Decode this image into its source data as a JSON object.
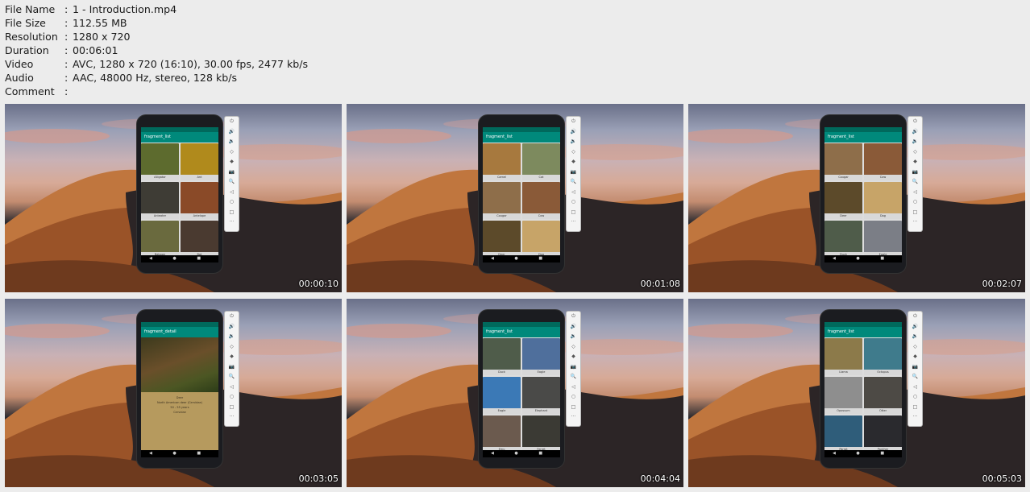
{
  "meta": [
    {
      "key": "File Name",
      "value": "1 - Introduction.mp4"
    },
    {
      "key": "File Size",
      "value": "112.55 MB"
    },
    {
      "key": "Resolution",
      "value": "1280 x 720"
    },
    {
      "key": "Duration",
      "value": "00:06:01"
    },
    {
      "key": "Video",
      "value": "AVC, 1280 x 720 (16:10), 30.00 fps, 2477 kb/s"
    },
    {
      "key": "Audio",
      "value": "AAC, 48000 Hz, stereo, 128 kb/s"
    },
    {
      "key": "Comment",
      "value": ""
    }
  ],
  "separator": ":",
  "emulator_icons": [
    "⏻",
    "🔊",
    "🔉",
    "◇",
    "◆",
    "📷",
    "🔍",
    "◁",
    "○",
    "□",
    "···"
  ],
  "navbar": "◀ ● ■",
  "thumbs": [
    {
      "time": "00:00:10",
      "appbar": "fragment_list",
      "tiles": [
        {
          "label": "Alligator",
          "color": "#5d6b2e"
        },
        {
          "label": "Ant",
          "color": "#b08a1c"
        },
        {
          "label": "Anteater",
          "color": "#3e3c35"
        },
        {
          "label": "Antelope",
          "color": "#8a4a28"
        },
        {
          "label": "Baboon",
          "color": "#6a6a3e"
        },
        {
          "label": "Bat",
          "color": "#4a3a30"
        }
      ]
    },
    {
      "time": "00:01:08",
      "appbar": "fragment_list",
      "tiles": [
        {
          "label": "Camel",
          "color": "#a7793e"
        },
        {
          "label": "Cat",
          "color": "#7d8a5e"
        },
        {
          "label": "Cougar",
          "color": "#8e6e4a"
        },
        {
          "label": "Cow",
          "color": "#8a5a38"
        },
        {
          "label": "Deer",
          "color": "#5c4a2a"
        },
        {
          "label": "Dog",
          "color": "#c7a468"
        }
      ]
    },
    {
      "time": "00:02:07",
      "appbar": "fragment_list",
      "tiles": [
        {
          "label": "Cougar",
          "color": "#8e6e4a"
        },
        {
          "label": "Cow",
          "color": "#8a5a38"
        },
        {
          "label": "Deer",
          "color": "#5c4a2a"
        },
        {
          "label": "Dog",
          "color": "#c7a468"
        },
        {
          "label": "Duck",
          "color": "#4f5c4a"
        },
        {
          "label": "Eagle",
          "color": "#7b7e86"
        }
      ]
    },
    {
      "time": "00:03:05",
      "appbar": "fragment_detail",
      "detail": true,
      "detail_title": "Deer",
      "detail_lines": [
        "North American deer (Cervidae)",
        "50 - 55 years",
        "Cervidae"
      ]
    },
    {
      "time": "00:04:04",
      "appbar": "fragment_list",
      "tiles": [
        {
          "label": "Duck",
          "color": "#4f5c4a"
        },
        {
          "label": "Eagle",
          "color": "#4f6f9c"
        },
        {
          "label": "Eagle",
          "color": "#3b79b6"
        },
        {
          "label": "Elephant",
          "color": "#4a4a48"
        },
        {
          "label": "Emu",
          "color": "#6b5a4e"
        },
        {
          "label": "Ferret",
          "color": "#3b3a34"
        }
      ]
    },
    {
      "time": "00:05:03",
      "appbar": "fragment_list",
      "tiles": [
        {
          "label": "Llama",
          "color": "#8c7a4a"
        },
        {
          "label": "Octopus",
          "color": "#3f7b8c"
        },
        {
          "label": "Opossum",
          "color": "#8e8e8e"
        },
        {
          "label": "Otter",
          "color": "#4d4a45"
        },
        {
          "label": "Parrot",
          "color": "#2f5d7a"
        },
        {
          "label": "Panther",
          "color": "#2a2a2e"
        }
      ]
    }
  ]
}
